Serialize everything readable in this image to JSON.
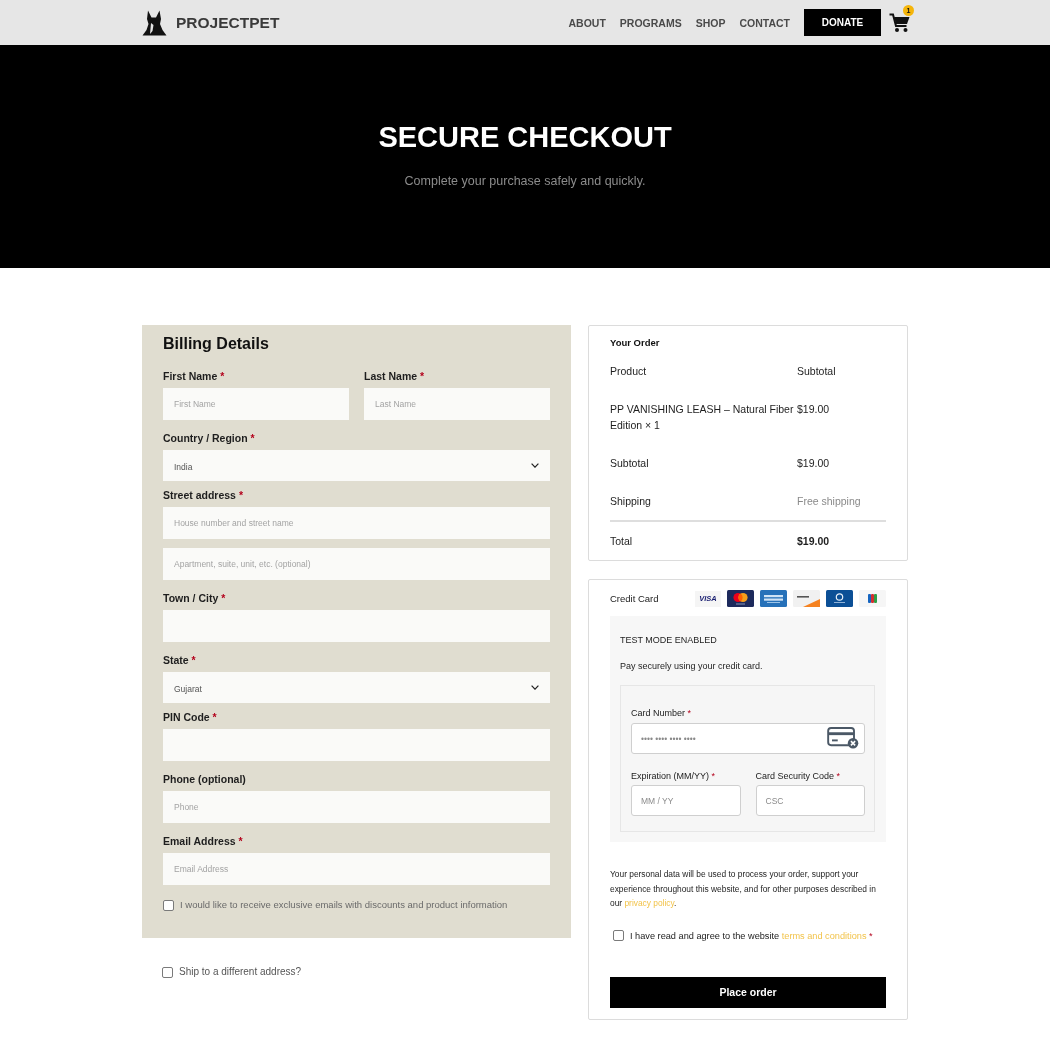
{
  "header": {
    "logo_text": "PROJECTPET",
    "nav": [
      {
        "label": "ABOUT"
      },
      {
        "label": "PROGRAMS"
      },
      {
        "label": "SHOP"
      },
      {
        "label": "CONTACT"
      }
    ],
    "donate_label": "DONATE",
    "cart_count": "1"
  },
  "hero": {
    "title": "SECURE CHECKOUT",
    "subtitle": "Complete your purchase safely and quickly."
  },
  "billing": {
    "title": "Billing Details",
    "rows": [
      {
        "fields": [
          {
            "kind": "text",
            "label": "First Name",
            "required_mark": "*",
            "placeholder": "First Name"
          },
          {
            "kind": "text",
            "label": "Last Name",
            "required_mark": "*",
            "placeholder": "Last Name"
          }
        ]
      },
      {
        "fields": [
          {
            "kind": "select",
            "label": "Country / Region",
            "required_mark": "*",
            "value": "India"
          }
        ]
      },
      {
        "fields": [
          {
            "kind": "text",
            "label": "Street address",
            "required_mark": "*",
            "placeholder": "House number and street name"
          }
        ]
      },
      {
        "fields": [
          {
            "kind": "text",
            "placeholder": "Apartment, suite, unit, etc. (optional)"
          }
        ]
      },
      {
        "fields": [
          {
            "kind": "text",
            "label": "Town / City",
            "required_mark": "*"
          }
        ]
      },
      {
        "fields": [
          {
            "kind": "select",
            "label": "State",
            "required_mark": "*",
            "value": "Gujarat"
          }
        ]
      },
      {
        "fields": [
          {
            "kind": "text",
            "label": "PIN Code",
            "required_mark": "*"
          }
        ]
      },
      {
        "fields": [
          {
            "kind": "text",
            "label": "Phone (optional)",
            "placeholder": "Phone"
          }
        ]
      },
      {
        "fields": [
          {
            "kind": "text",
            "label": "Email Address",
            "required_mark": "*",
            "placeholder": "Email Address"
          }
        ]
      }
    ],
    "newsletter": {
      "label": "I would like to receive exclusive emails with discounts and product information",
      "checked": false
    }
  },
  "ship_to_different": {
    "label": "Ship to a different address?",
    "checked": false
  },
  "order": {
    "title": "Your Order",
    "columns": [
      "Product",
      "Subtotal"
    ],
    "rows": [
      {
        "kind": "item",
        "label": "PP VANISHING LEASH – Natural Fiber Edition × 1",
        "value": "$19.00"
      },
      {
        "kind": "line",
        "label": "Subtotal",
        "value": "$19.00"
      },
      {
        "kind": "shipping",
        "label": "Shipping",
        "value": "Free shipping"
      },
      {
        "kind": "total",
        "label": "Total",
        "value": "$19.00"
      }
    ]
  },
  "payment": {
    "method_label": "Credit Card",
    "card_logos": [
      {
        "kind": "visa",
        "text": "VISA"
      },
      {
        "kind": "mastercard"
      },
      {
        "kind": "amex"
      },
      {
        "kind": "discover"
      },
      {
        "kind": "diners"
      },
      {
        "kind": "jcb"
      }
    ],
    "notice": "TEST MODE ENABLED",
    "description": "Pay securely using your credit card.",
    "card_fields": [
      {
        "kind": "card_number",
        "label": "Card Number",
        "required_mark": "*",
        "placeholder": "•••• •••• •••• ••••"
      },
      {
        "kind": "expiry",
        "label": "Expiration (MM/YY)",
        "required_mark": "*",
        "placeholder": "MM / YY"
      },
      {
        "kind": "csc",
        "label": "Card Security Code",
        "required_mark": "*",
        "placeholder": "CSC"
      }
    ],
    "privacy": {
      "text": "Your personal data will be used to process your order, support your experience throughout this website, and for other purposes described in our",
      "link": "privacy policy",
      "end": "."
    },
    "terms": {
      "checked": false,
      "text": "I have read and agree to the website",
      "link": "terms and conditions",
      "required_mark": "*"
    },
    "place_order_label": "Place order"
  }
}
